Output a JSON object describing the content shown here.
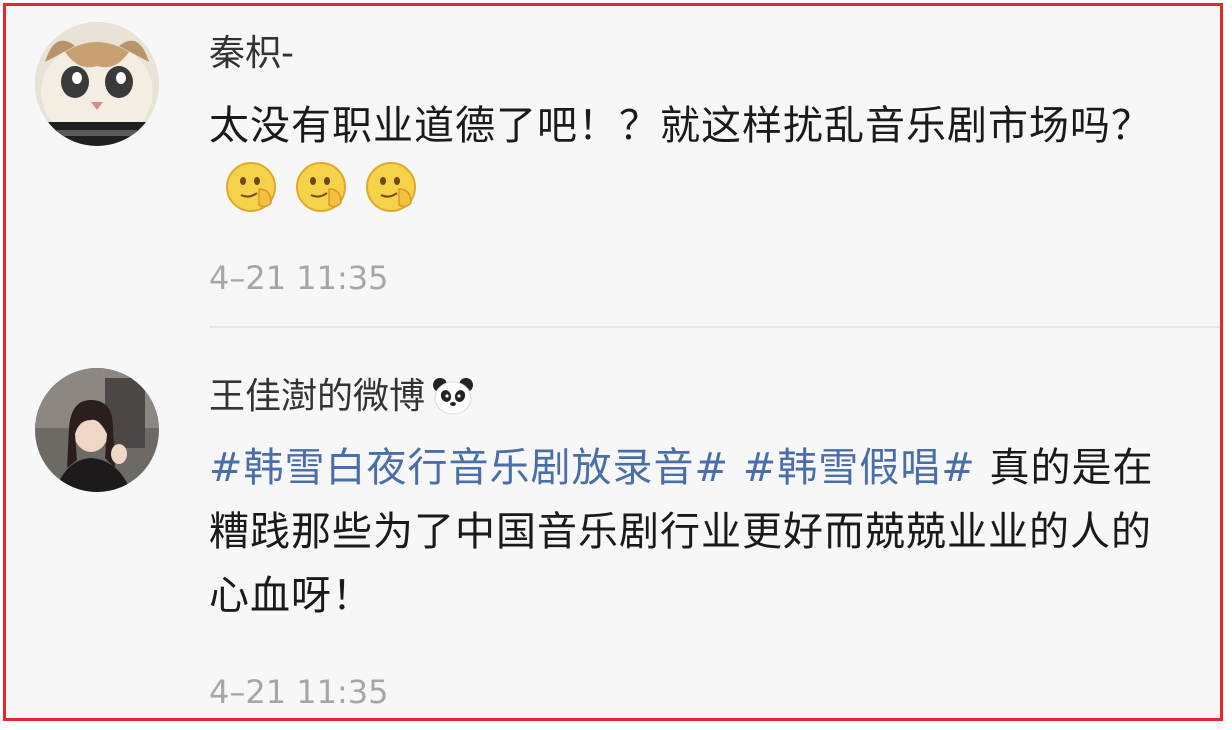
{
  "comments": [
    {
      "username": "秦枳-",
      "content_text": "太没有职业道德了吧！？就这样扰乱音乐剧市场吗？",
      "emoji_icons": [
        "smirk-emoji-icon",
        "smirk-emoji-icon",
        "smirk-emoji-icon"
      ],
      "timestamp": "4–21 11:35"
    },
    {
      "username": "王佳澍的微博",
      "username_icon": "panda-icon",
      "hashtags": [
        "#韩雪白夜行音乐剧放录音#",
        "#韩雪假唱#"
      ],
      "content_text": "真的是在糟践那些为了中国音乐剧行业更好而兢兢业业的人的心血呀！",
      "timestamp": "4–21 11:35"
    }
  ],
  "colors": {
    "frame_border": "#e8262c",
    "background": "#f7f7f7",
    "hashtag": "#4a6ea8",
    "timestamp": "#a6a6a6"
  }
}
